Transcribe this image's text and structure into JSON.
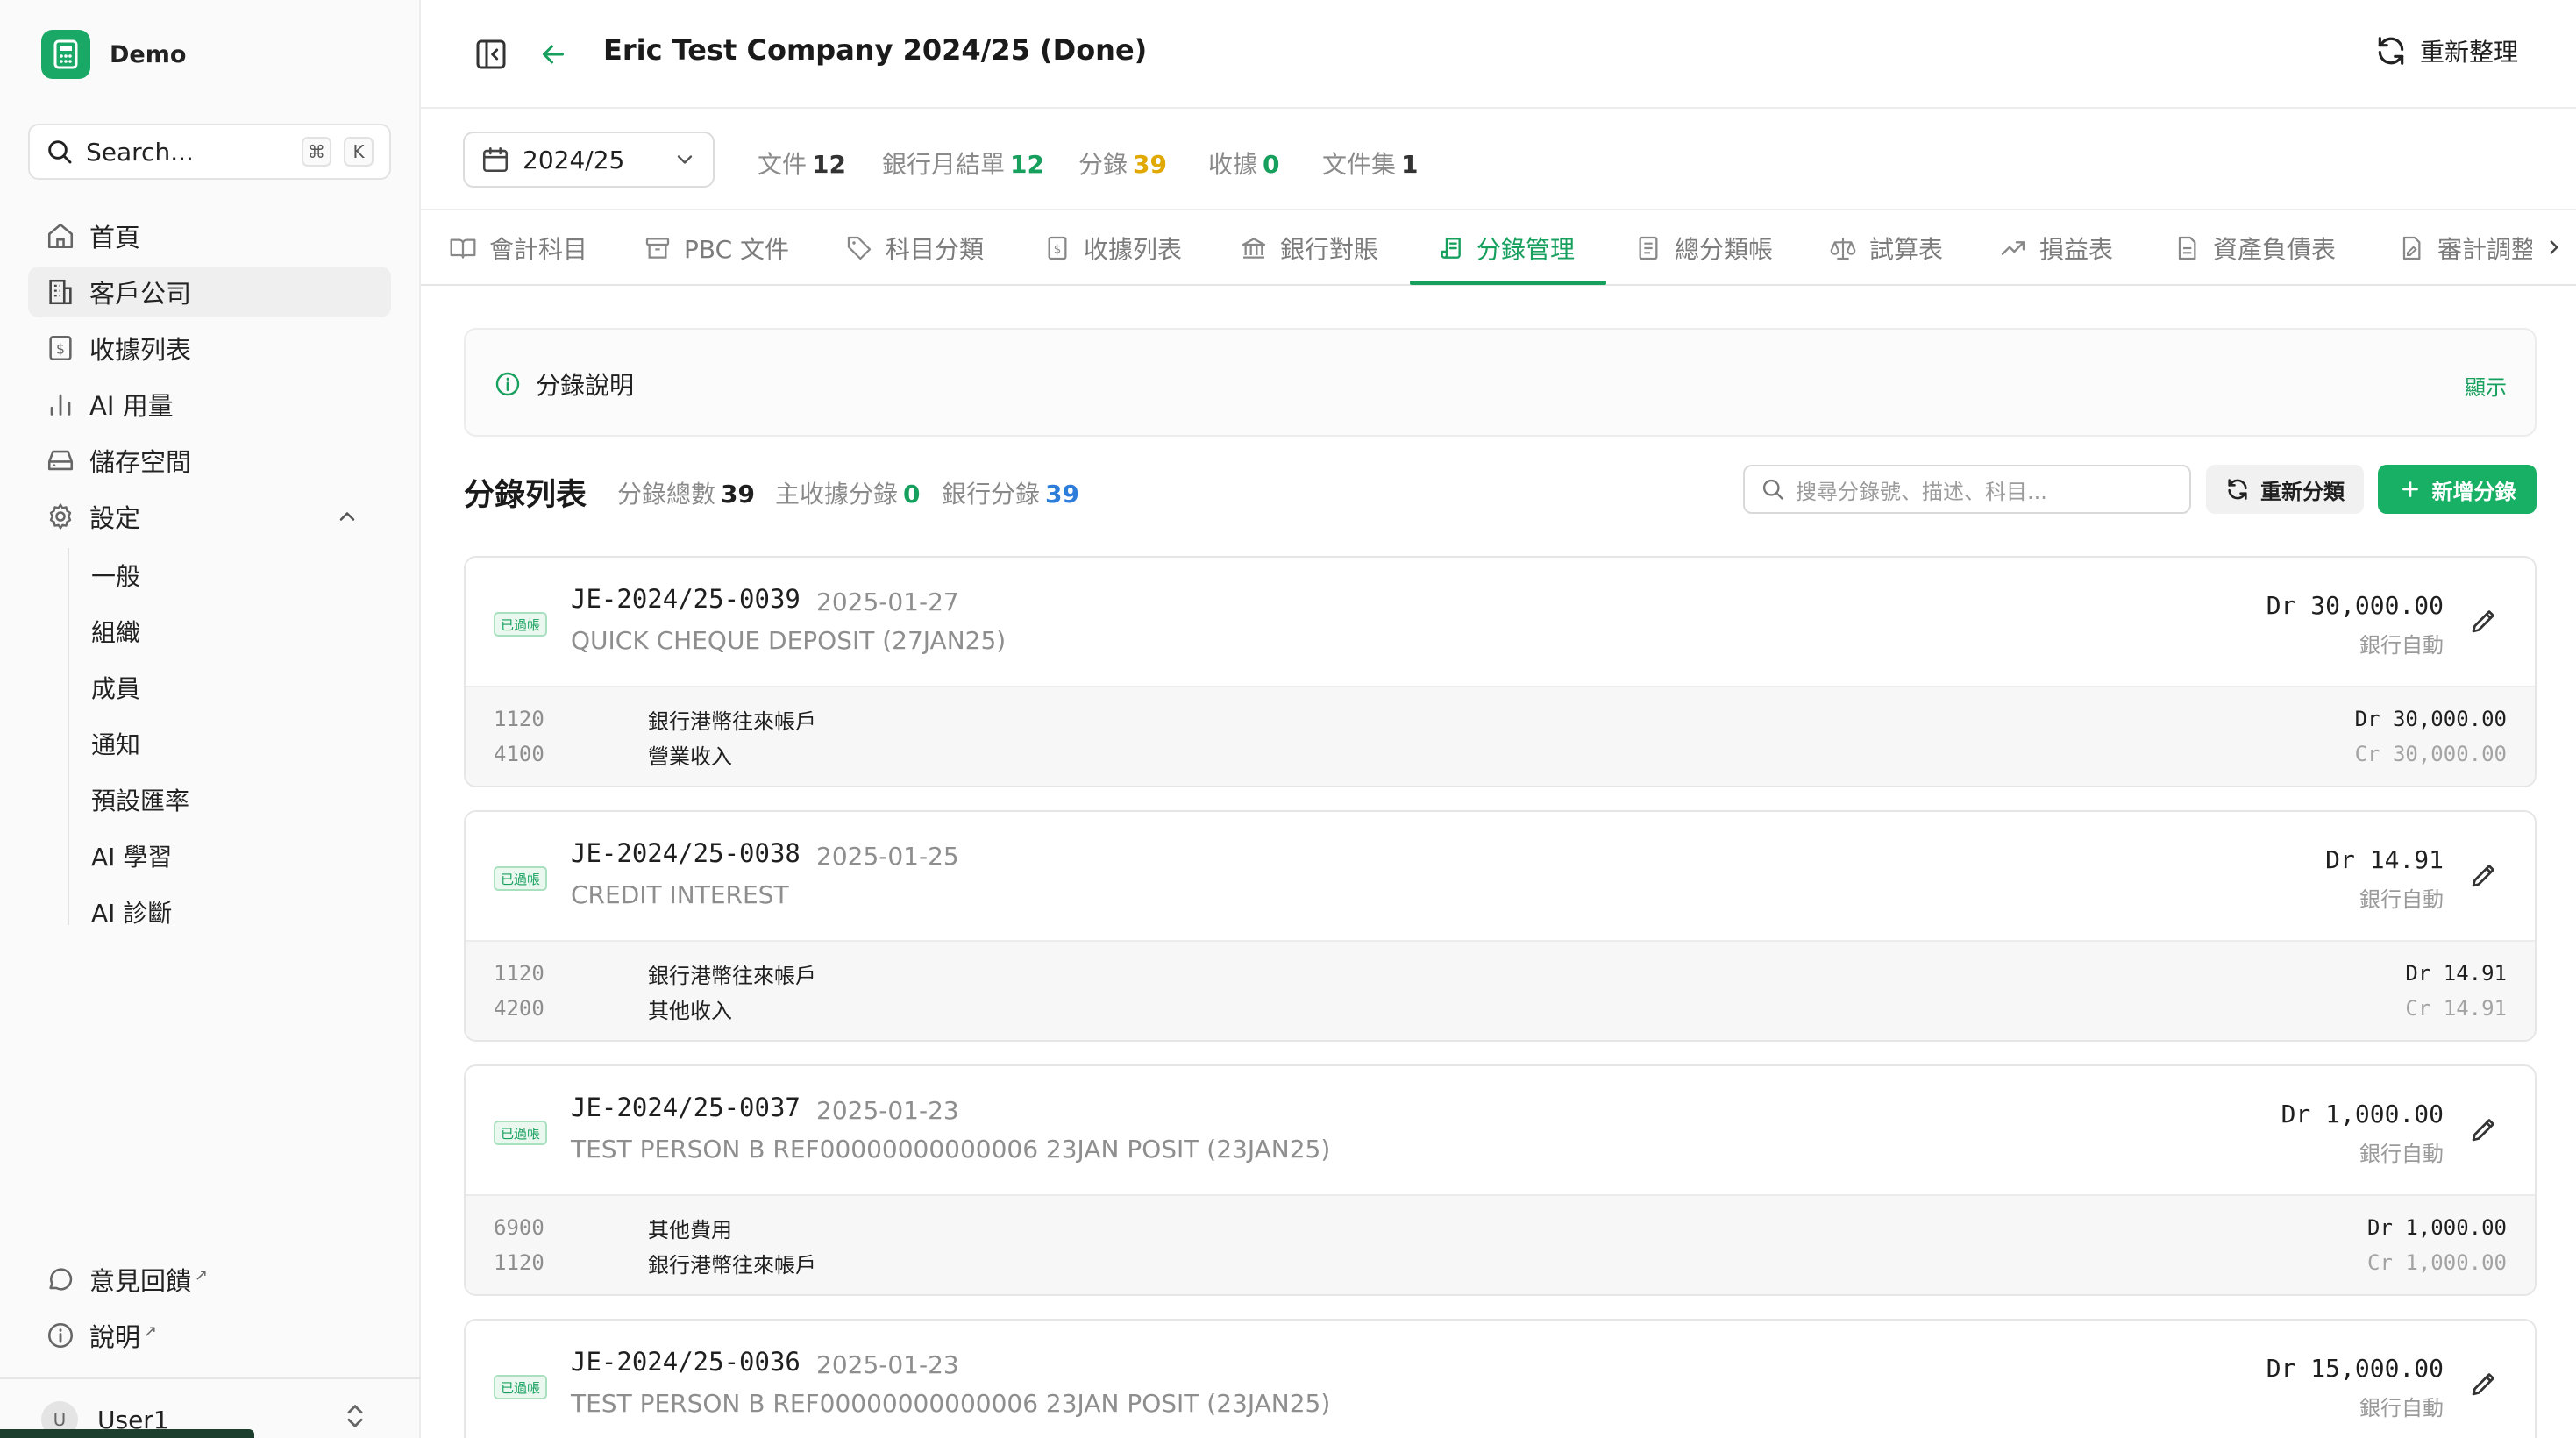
{
  "app": {
    "name": "Demo"
  },
  "sidebar": {
    "search": {
      "label": "Search...",
      "kbd_cmd": "⌘",
      "kbd_key": "K"
    },
    "items": [
      {
        "label": "首頁",
        "icon": "home-icon"
      },
      {
        "label": "客戶公司",
        "icon": "building-icon"
      },
      {
        "label": "收據列表",
        "icon": "receipt-icon"
      },
      {
        "label": "AI 用量",
        "icon": "bar-chart-icon"
      },
      {
        "label": "儲存空間",
        "icon": "storage-icon"
      },
      {
        "label": "設定",
        "icon": "gear-icon"
      }
    ],
    "settings_sub": [
      "一般",
      "組織",
      "成員",
      "通知",
      "預設匯率",
      "AI 學習",
      "AI 診斷"
    ],
    "footer": {
      "feedback": "意見回饋",
      "help": "說明"
    },
    "user": {
      "initial": "U",
      "name": "User1"
    }
  },
  "header": {
    "title": "Eric Test Company 2024/25 (Done)",
    "refresh_label": "重新整理"
  },
  "period": {
    "selected": "2024/25",
    "stats": [
      {
        "label": "文件",
        "value": "12",
        "color": "#333333"
      },
      {
        "label": "銀行月結單",
        "value": "12",
        "color": "#17a05d"
      },
      {
        "label": "分錄",
        "value": "39",
        "color": "#e0a800"
      },
      {
        "label": "收據",
        "value": "0",
        "color": "#17a05d"
      },
      {
        "label": "文件集",
        "value": "1",
        "color": "#333333"
      }
    ]
  },
  "tabs": [
    "會計科目",
    "PBC 文件",
    "科目分類",
    "收據列表",
    "銀行對賬",
    "分錄管理",
    "總分類帳",
    "試算表",
    "損益表",
    "資產負債表",
    "審計調整"
  ],
  "info": {
    "title": "分錄說明",
    "toggle": "顯示"
  },
  "list": {
    "title": "分錄列表",
    "total_label": "分錄總數",
    "total": "39",
    "receipt_label": "主收據分錄",
    "receipt": "0",
    "bank_label": "銀行分錄",
    "bank": "39",
    "search_placeholder": "搜尋分錄號、描述、科目...",
    "reclassify_label": "重新分類",
    "add_label": "新增分錄"
  },
  "entries": [
    {
      "badge": "已過帳",
      "no": "JE-2024/25-0039",
      "date": "2025-01-27",
      "desc": "QUICK CHEQUE DEPOSIT (27JAN25)",
      "amount": "Dr 30,000.00",
      "source": "銀行自動",
      "lines": [
        {
          "acct": "1120",
          "name": "銀行港幣往來帳戶",
          "amt": "Dr 30,000.00"
        },
        {
          "acct": "4100",
          "name": "營業收入",
          "amt": "Cr 30,000.00"
        }
      ]
    },
    {
      "badge": "已過帳",
      "no": "JE-2024/25-0038",
      "date": "2025-01-25",
      "desc": "CREDIT INTEREST",
      "amount": "Dr 14.91",
      "source": "銀行自動",
      "lines": [
        {
          "acct": "1120",
          "name": "銀行港幣往來帳戶",
          "amt": "Dr 14.91"
        },
        {
          "acct": "4200",
          "name": "其他收入",
          "amt": "Cr 14.91"
        }
      ]
    },
    {
      "badge": "已過帳",
      "no": "JE-2024/25-0037",
      "date": "2025-01-23",
      "desc": "TEST PERSON B REF00000000000006 23JAN POSIT (23JAN25)",
      "amount": "Dr 1,000.00",
      "source": "銀行自動",
      "lines": [
        {
          "acct": "6900",
          "name": "其他費用",
          "amt": "Dr 1,000.00"
        },
        {
          "acct": "1120",
          "name": "銀行港幣往來帳戶",
          "amt": "Cr 1,000.00"
        }
      ]
    },
    {
      "badge": "已過帳",
      "no": "JE-2024/25-0036",
      "date": "2025-01-23",
      "desc": "TEST PERSON B REF00000000000006 23JAN POSIT (23JAN25)",
      "amount": "Dr 15,000.00",
      "source": "銀行自動",
      "lines": []
    }
  ]
}
